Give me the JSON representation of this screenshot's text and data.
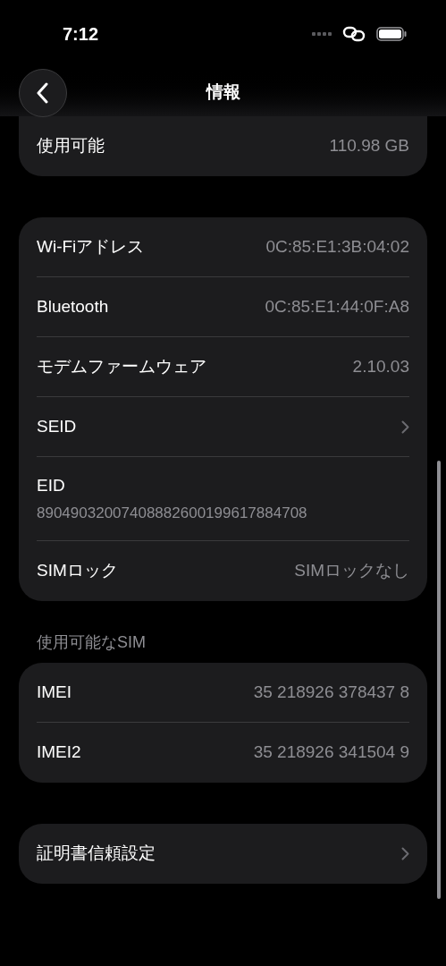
{
  "status_bar": {
    "time": "7:12"
  },
  "header": {
    "title": "情報"
  },
  "groups": [
    {
      "rows": [
        {
          "kind": "value",
          "label": "使用可能",
          "value": "110.98 GB"
        }
      ]
    },
    {
      "rows": [
        {
          "kind": "value",
          "label": "Wi-Fiアドレス",
          "value": "0C:85:E1:3B:04:02"
        },
        {
          "kind": "value",
          "label": "Bluetooth",
          "value": "0C:85:E1:44:0F:A8"
        },
        {
          "kind": "value",
          "label": "モデムファームウェア",
          "value": "2.10.03"
        },
        {
          "kind": "chevron",
          "label": "SEID"
        },
        {
          "kind": "stacked",
          "label": "EID",
          "value": "89049032007408882600199617884708"
        },
        {
          "kind": "value",
          "label": "SIMロック",
          "value": "SIMロックなし"
        }
      ]
    },
    {
      "section_title": "使用可能なSIM",
      "rows": [
        {
          "kind": "value",
          "label": "IMEI",
          "value": "35 218926 378437 8"
        },
        {
          "kind": "value",
          "label": "IMEI2",
          "value": "35 218926 341504 9"
        }
      ]
    },
    {
      "rows": [
        {
          "kind": "chevron",
          "label": "証明書信頼設定"
        }
      ]
    }
  ]
}
